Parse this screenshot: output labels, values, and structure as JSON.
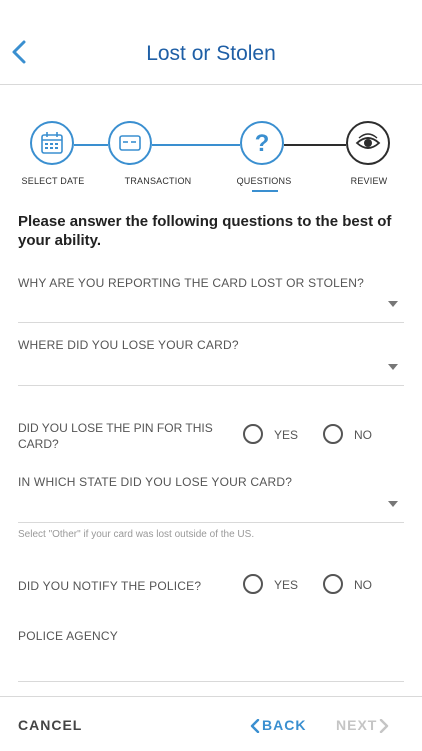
{
  "header": {
    "title": "Lost or Stolen",
    "back_icon": "chevron-left-icon"
  },
  "stepper": {
    "steps": [
      {
        "label": "SELECT DATE",
        "icon": "calendar-icon"
      },
      {
        "label": "TRANSACTION",
        "icon": "card-icon"
      },
      {
        "label": "QUESTIONS",
        "icon": "question-icon"
      },
      {
        "label": "REVIEW",
        "icon": "eye-icon"
      }
    ],
    "active_step": 2
  },
  "intro": "Please answer the following questions to the best of your ability.",
  "form": {
    "q_reason": {
      "label": "WHY ARE YOU REPORTING THE CARD LOST OR STOLEN?"
    },
    "q_where": {
      "label": "WHERE DID YOU LOSE YOUR CARD?"
    },
    "q_pin": {
      "label": "DID YOU LOSE THE PIN FOR THIS CARD?",
      "yes": "YES",
      "no": "NO"
    },
    "q_state": {
      "label": "IN WHICH STATE DID YOU LOSE YOUR CARD?",
      "hint": "Select \"Other\" if your card was lost outside of the US."
    },
    "q_police": {
      "label": "DID YOU NOTIFY THE POLICE?",
      "yes": "YES",
      "no": "NO"
    },
    "q_agency": {
      "label": "POLICE AGENCY"
    }
  },
  "footer": {
    "cancel": "CANCEL",
    "back": "BACK",
    "next": "NEXT"
  },
  "colors": {
    "accent": "#3a8fd0",
    "title": "#1f5fa6",
    "disabled": "#c5c5c5"
  }
}
